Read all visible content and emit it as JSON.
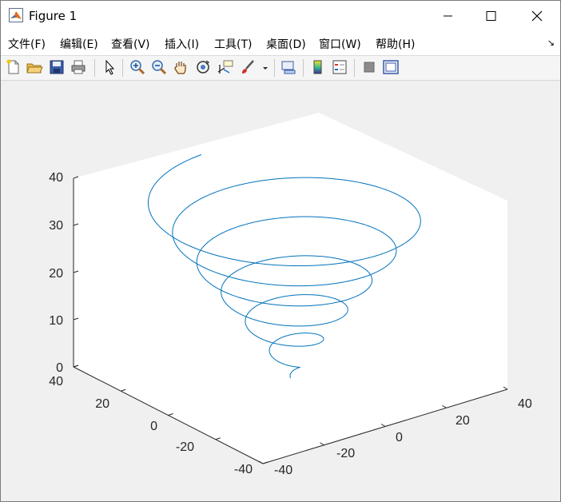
{
  "window": {
    "title": "Figure 1"
  },
  "menu": [
    {
      "label": "文件(F)",
      "name": "menu-file"
    },
    {
      "label": "编辑(E)",
      "name": "menu-edit"
    },
    {
      "label": "查看(V)",
      "name": "menu-view"
    },
    {
      "label": "插入(I)",
      "name": "menu-insert"
    },
    {
      "label": "工具(T)",
      "name": "menu-tools"
    },
    {
      "label": "桌面(D)",
      "name": "menu-desktop"
    },
    {
      "label": "窗口(W)",
      "name": "menu-window"
    },
    {
      "label": "帮助(H)",
      "name": "menu-help"
    }
  ],
  "toolbar": [
    "new-figure-icon",
    "open-file-icon",
    "save-icon",
    "print-icon",
    "pointer-icon",
    "zoom-in-icon",
    "zoom-out-icon",
    "pan-hand-icon",
    "rotate-3d-icon",
    "data-cursor-icon",
    "brush-icon",
    "link-plot-icon",
    "colorbar-icon",
    "legend-icon",
    "hide-plot-tools-icon",
    "show-plot-tools-icon"
  ],
  "plot": {
    "line_color": "#0072bd",
    "z_ticks": [
      "0",
      "10",
      "20",
      "30",
      "40"
    ],
    "x_ticks": [
      "-40",
      "-20",
      "0",
      "20",
      "40"
    ],
    "y_ticks": [
      "-40",
      "-20",
      "0",
      "20",
      "40"
    ]
  },
  "chart_data": {
    "type": "line",
    "title": "",
    "xlabel": "",
    "ylabel": "",
    "zlabel": "",
    "xlim": [
      -40,
      40
    ],
    "ylim": [
      -40,
      40
    ],
    "zlim": [
      0,
      40
    ],
    "grid": false,
    "view": "3-D default (azimuth -37.5, elevation 30)",
    "series": [
      {
        "description": "conical helix",
        "x": "t*cos(t)",
        "y": "t*sin(t)",
        "z": "t",
        "t_range": [
          0,
          37.7
        ]
      }
    ]
  }
}
